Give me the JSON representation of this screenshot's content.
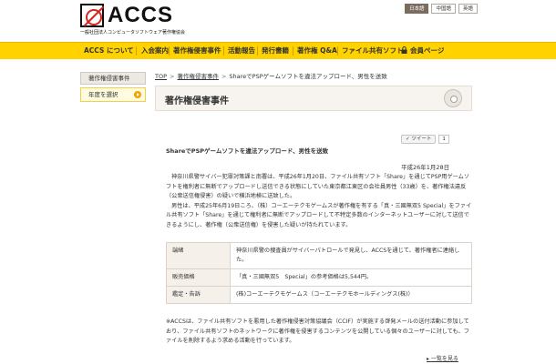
{
  "header": {
    "logo_text": "ACCS",
    "logo_subtitle": "一般社団法人コンピュータソフトウェア著作権協会",
    "languages": [
      "日本語",
      "中国語",
      "英語"
    ]
  },
  "nav": {
    "items": [
      "ACCS について",
      "入会案内",
      "著作権侵害事件",
      "活動報告",
      "発行書籍",
      "著作権 Q&A",
      "ファイル共有ソフト"
    ],
    "member": "会員ページ"
  },
  "sidebar": {
    "title": "著作権侵害事件",
    "items": [
      {
        "label": "年度を選択"
      }
    ]
  },
  "breadcrumb": {
    "top": "TOP",
    "section": "著作権侵害事件",
    "current": "ShareでPSPゲームソフトを違法アップロード、男性を送致"
  },
  "page": {
    "title": "著作権侵害事件"
  },
  "article": {
    "tweet_label": "ツイート",
    "tweet_count": "1",
    "title": "ShareでPSPゲームソフトを違法アップロード、男性を送致",
    "date": "平成26年1月28日",
    "paragraphs": [
      "神奈川県警サイバー犯罪対策課と南署は、平成26年1月20日、ファイル共有ソフト「Share」を通じてPSP用ゲームソフトを権利者に無断でアップロードし送信できる状態にしていた東京都江東区の会社員男性（33歳）を、著作権法違反（公衆送信権侵害）の疑いで横浜地検に送致した。",
      "男性は、平成25年6月19日ころ、（株）コーエーテクモゲームスが著作権を有する「真・三國無双5 Special」をファイル共有ソフト「Share」を通じて権利者に無断でアップロードして不特定多数のインターネットユーザーに対して送信できるようにし、著作権（公衆送信権）を侵害した疑いが持たれています。"
    ]
  },
  "info_table": [
    {
      "key": "端緒",
      "value": "神奈川県警の捜査員がサイバーパトロールで発見し、ACCSを通じて、著作権者に連絡した。"
    },
    {
      "key": "販売価格",
      "value": "「真・三國無双5　Special」の参考価格は5,544円。"
    },
    {
      "key": "鑑定・告訴",
      "value": "(株)コーエーテクモゲームス（コーエーテクモホールディングス(株)）"
    }
  ],
  "note": "※ACCSは、ファイル共有ソフトを悪用した著作権侵害対策協議会（CCIF）が実施する啓発メールの送付活動に参加しており、ファイル共有ソフトのネットワークに著作権を侵害するコンテンツを公開している個々のユーザーに対しても、ファイルを削除するよう求める活動を行っています。",
  "back_link": "一覧を見る",
  "colors": {
    "nav_bg": "#ffd200",
    "logo_red": "#d8231f",
    "lang_active": "#7a6d60"
  }
}
